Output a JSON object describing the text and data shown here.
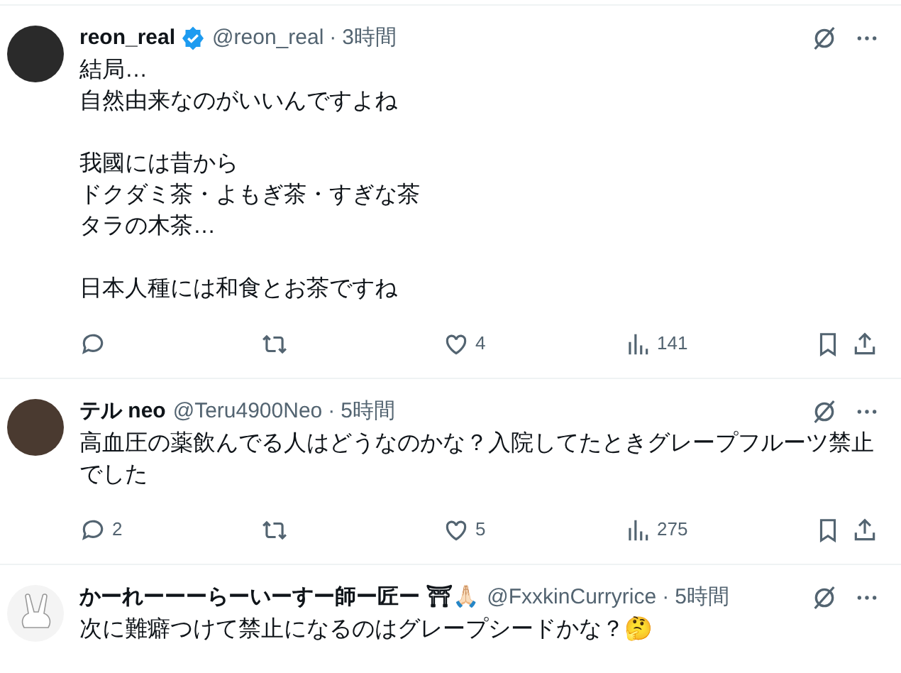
{
  "posts": [
    {
      "name": "reon_real",
      "verified": true,
      "handle": "@reon_real",
      "separator": "·",
      "time": "3時間",
      "paragraphs": [
        [
          "結局…",
          "自然由来なのがいいんですよね"
        ],
        [
          "我國には昔から",
          "ドクダミ茶・よもぎ茶・すぎな茶",
          "タラの木茶…"
        ],
        [
          "日本人種には和食とお茶ですね"
        ]
      ],
      "likes": "4",
      "views": "141"
    },
    {
      "name": "テル neo",
      "verified": false,
      "handle": "@Teru4900Neo",
      "separator": "·",
      "time": "5時間",
      "paragraphs": [
        [
          "高血圧の薬飲んでる人はどうなのかな？入院してたときグレープフルーツ禁止でした"
        ]
      ],
      "replies": "2",
      "likes": "5",
      "views": "275"
    },
    {
      "name": "かーれーーーらーいーすー師ー匠ー ⛩🙏🏻",
      "verified": false,
      "handle": "@FxxkinCurryrice",
      "separator": "·",
      "time": "5時間",
      "paragraphs": [
        [
          "次に難癖つけて禁止になるのはグレープシードかな？🤔"
        ]
      ]
    }
  ]
}
